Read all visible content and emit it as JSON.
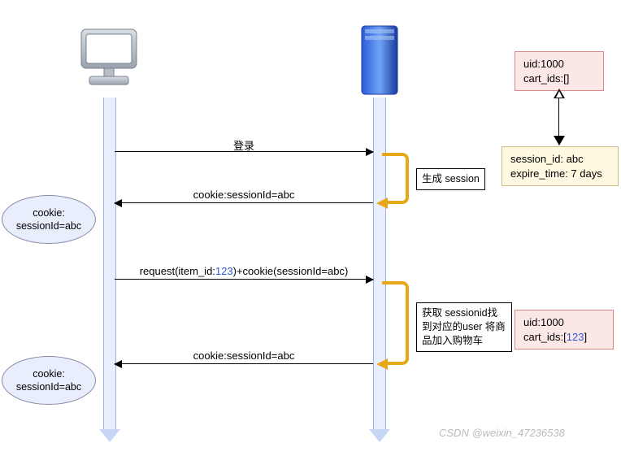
{
  "actors": {
    "client": "",
    "server": ""
  },
  "msg1": "登录",
  "self1": "生成 session",
  "msg2a": "cookie:sessionId=",
  "msg2b": "abc",
  "msg3a": "request(item_id:",
  "msg3b": "123",
  "msg3c": ")+cookie(sessionId=",
  "msg3d": "abc",
  "msg3e": ")",
  "self2": "获取 sessionid找到对应的user 将商品加入购物车",
  "msg4a": "cookie:sessionId=",
  "msg4b": "abc",
  "userbox1": {
    "l1": "uid:1000",
    "l2": "cart_ids:[]"
  },
  "sessbox": {
    "l1": "session_id: abc",
    "l2": "expire_time: 7 days"
  },
  "userbox2": {
    "l1": "uid:1000",
    "l2a": "cart_ids:[",
    "l2b": "123",
    "l2c": "]"
  },
  "cookie1": {
    "l1": "cookie:",
    "l2": "sessionId=abc"
  },
  "cookie2": {
    "l1": "cookie:",
    "l2": "sessionId=abc"
  },
  "watermark": "CSDN @weixin_47236538"
}
